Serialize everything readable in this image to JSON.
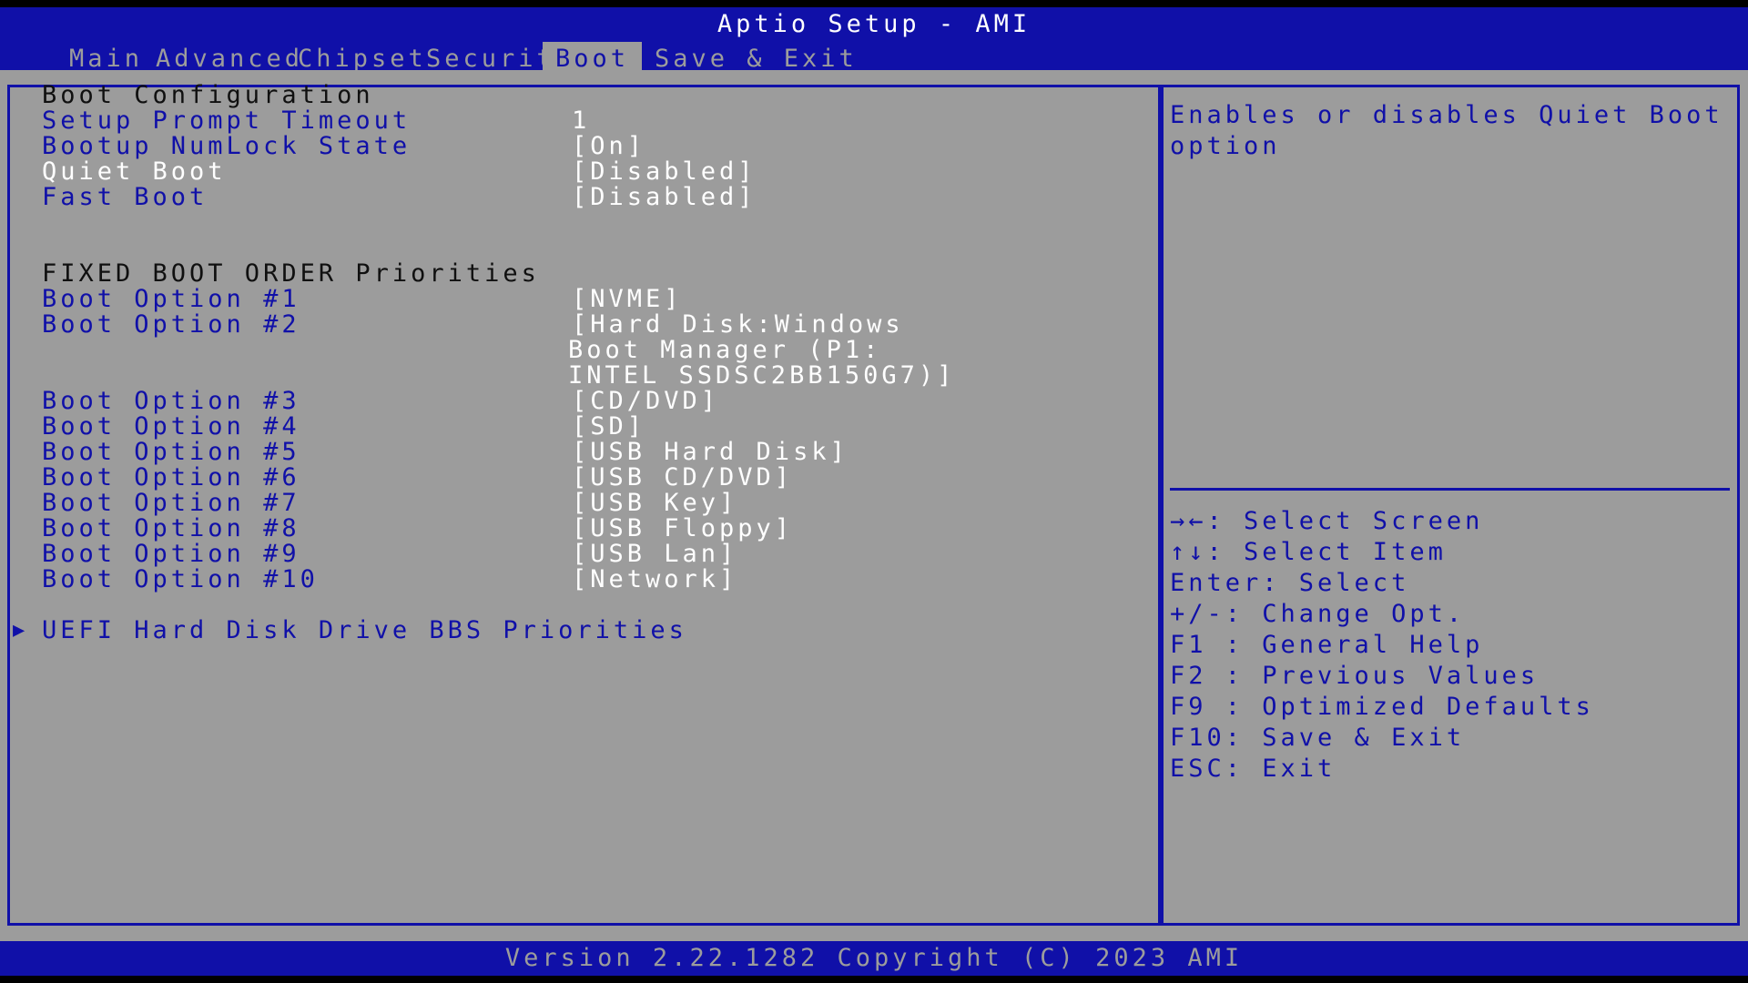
{
  "header": {
    "title": "Aptio Setup - AMI",
    "tabs": [
      "Main",
      "Advanced",
      "Chipset",
      "Security",
      "Boot",
      "Save & Exit"
    ],
    "active_tab": "Boot"
  },
  "boot": {
    "section_title": "Boot Configuration",
    "setup_prompt_timeout": {
      "label": "Setup Prompt Timeout",
      "value": "1"
    },
    "bootup_numlock_state": {
      "label": "Bootup NumLock State",
      "value": "[On]"
    },
    "quiet_boot": {
      "label": "Quiet Boot",
      "value": "[Disabled]"
    },
    "fast_boot": {
      "label": "Fast Boot",
      "value": "[Disabled]"
    },
    "fixed_order_title": "FIXED BOOT ORDER Priorities",
    "options": [
      {
        "label": "Boot Option #1",
        "value": "[NVME]"
      },
      {
        "label": "Boot Option #2",
        "value": "[Hard Disk:Windows",
        "value_line2": "Boot Manager (P1:",
        "value_line3": "INTEL SSDSC2BB150G7)]"
      },
      {
        "label": "Boot Option #3",
        "value": "[CD/DVD]"
      },
      {
        "label": "Boot Option #4",
        "value": "[SD]"
      },
      {
        "label": "Boot Option #5",
        "value": "[USB Hard Disk]"
      },
      {
        "label": "Boot Option #6",
        "value": "[USB CD/DVD]"
      },
      {
        "label": "Boot Option #7",
        "value": "[USB Key]"
      },
      {
        "label": "Boot Option #8",
        "value": "[USB Floppy]"
      },
      {
        "label": "Boot Option #9",
        "value": "[USB Lan]"
      },
      {
        "label": "Boot Option #10",
        "value": "[Network]"
      }
    ],
    "submenu": "UEFI Hard Disk Drive BBS Priorities"
  },
  "help": {
    "description": "Enables or disables Quiet Boot\noption",
    "keys": [
      "→←: Select Screen",
      "↑↓: Select Item",
      "Enter: Select",
      "+/-: Change Opt.",
      "F1 : General Help",
      "F2 : Previous Values",
      "F9 : Optimized Defaults",
      "F10: Save & Exit",
      "ESC: Exit"
    ]
  },
  "footer": {
    "version": "Version 2.22.1282 Copyright (C) 2023 AMI"
  },
  "colors": {
    "background": "#9c9c9c",
    "bar": "#1010a8",
    "text_white": "#ffffff"
  }
}
